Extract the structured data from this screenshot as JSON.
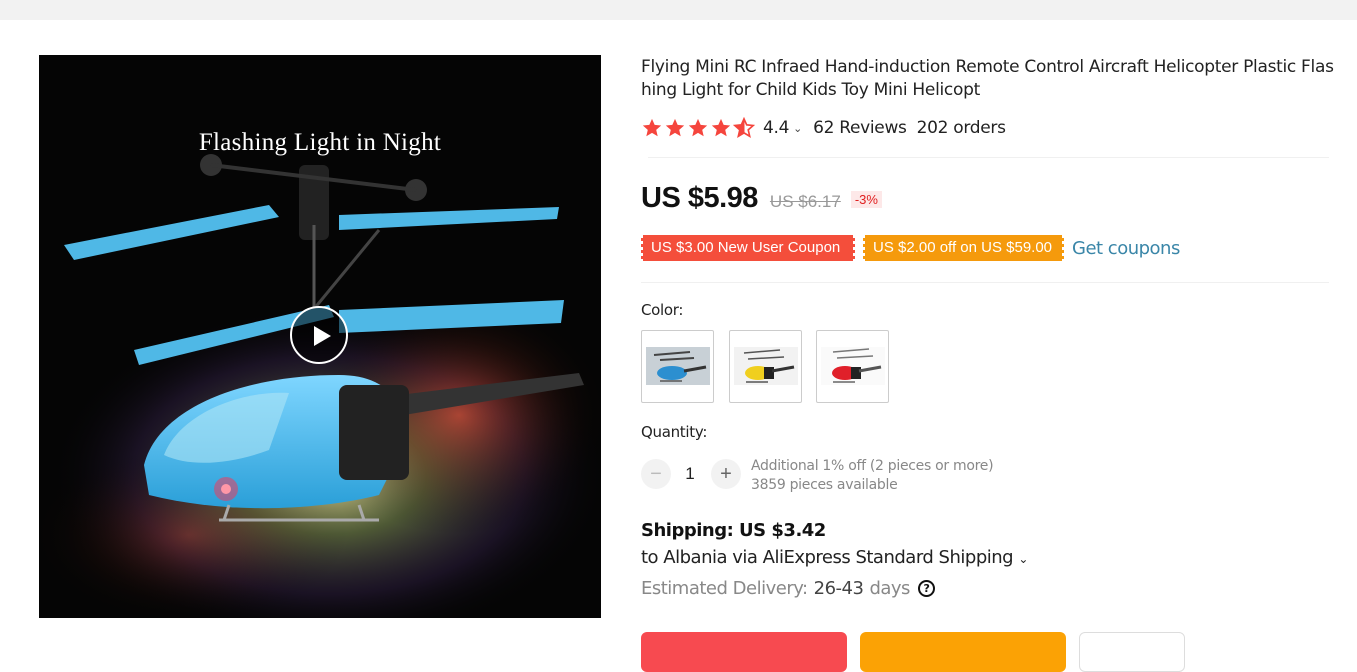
{
  "gallery": {
    "image_caption": "Flashing Light in Night",
    "thumbnails": [
      "thumb-1",
      "thumb-2",
      "thumb-3",
      "thumb-4",
      "thumb-5",
      "thumb-6"
    ]
  },
  "product": {
    "title": "Flying Mini RC Infraed Hand-induction Remote Control Aircraft Helicopter Plastic Flashing Light for Child Kids Toy Mini Helicopt",
    "rating": "4.4",
    "rating_stars": 4.4,
    "reviews": "62 Reviews",
    "orders": "202 orders",
    "price": "US $5.98",
    "original_price": "US $6.17",
    "discount": "-3%",
    "coupons": {
      "new_user": "US $3.00 New User Coupon",
      "store": "US $2.00 off on US $59.00",
      "get_link": "Get coupons"
    },
    "color_label": "Color:",
    "color_options": [
      "blue",
      "yellow",
      "red"
    ],
    "quantity_label": "Quantity:",
    "quantity_value": "1",
    "minus": "−",
    "plus": "+",
    "quantity_note": "Additional 1% off (2 pieces or more)",
    "stock": "3859 pieces available"
  },
  "shipping": {
    "cost": "Shipping: US $3.42",
    "route": "to Albania via AliExpress Standard Shipping",
    "route_caret": "⌄",
    "delivery_label": "Estimated Delivery:",
    "delivery_days": "26-43",
    "delivery_unit": "days",
    "help": "?"
  },
  "colors": {
    "star": "#f5453d",
    "price_red": "#f44e3b",
    "coupon_orange": "#f59a0c",
    "link": "#3a86a8",
    "buy": "#f74a50",
    "cart": "#fba205"
  }
}
